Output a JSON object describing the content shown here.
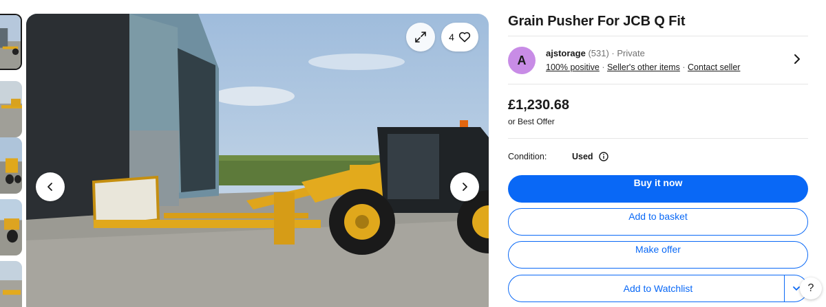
{
  "listing": {
    "title": "Grain Pusher For JCB Q Fit",
    "watch_count": "4",
    "price": "£1,230.68",
    "best_offer": "or Best Offer",
    "condition_label": "Condition:",
    "condition_value": "Used"
  },
  "seller": {
    "avatar_letter": "A",
    "name": "ajstorage",
    "feedback": "(531)",
    "separator": "·",
    "type": "Private",
    "positive": "100% positive",
    "other_items": "Seller's other items",
    "contact": "Contact seller"
  },
  "actions": {
    "buy_now": "Buy it now",
    "add_basket": "Add to basket",
    "make_offer": "Make offer",
    "add_watchlist": "Add to Watchlist"
  },
  "help": "?",
  "icons": {
    "expand": "expand-icon",
    "heart": "heart-icon",
    "prev": "chevron-left-icon",
    "next": "chevron-right-icon",
    "info": "info-icon",
    "dropdown": "chevron-down-icon"
  },
  "colors": {
    "accent": "#0968f6",
    "avatar": "#c88ce6",
    "text": "#191919",
    "muted": "#707070"
  }
}
